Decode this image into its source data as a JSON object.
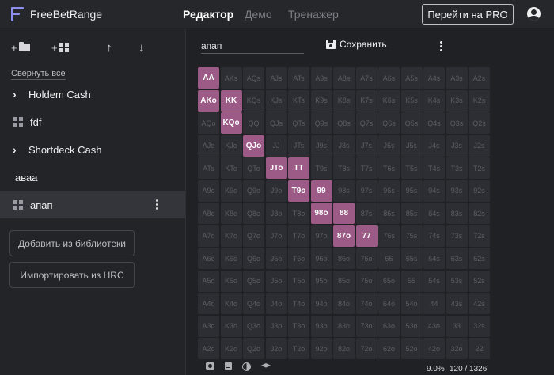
{
  "app": {
    "name": "FreeBetRange",
    "accent": "#8e8ef0"
  },
  "nav": {
    "editor": "Редактор",
    "demo": "Демо",
    "trainer": "Тренажер"
  },
  "header": {
    "pro_button": "Перейти на PRO"
  },
  "sidebar": {
    "collapse_all": "Свернуть все",
    "items": [
      {
        "label": "Holdem Cash",
        "kind": "folder"
      },
      {
        "label": "fdf",
        "kind": "range"
      },
      {
        "label": "Shortdeck Cash",
        "kind": "folder"
      },
      {
        "label": "аваа",
        "kind": "plain"
      },
      {
        "label": "апап",
        "kind": "range",
        "active": true
      }
    ],
    "add_from_library": "Добавить из библиотеки",
    "import_hrc": "Импортировать из HRC"
  },
  "editor": {
    "range_name": "апап",
    "save_label": "Сохранить",
    "selected_color": "#9c5b86",
    "ranks": [
      "A",
      "K",
      "Q",
      "J",
      "T",
      "9",
      "8",
      "7",
      "6",
      "5",
      "4",
      "3",
      "2"
    ],
    "selected_hands": [
      "AA",
      "AKo",
      "KK",
      "KQo",
      "QJo",
      "JTo",
      "TT",
      "T9o",
      "99",
      "98o",
      "88",
      "87o",
      "77"
    ],
    "percent": "9.0%",
    "combos": "120 / 1326"
  }
}
